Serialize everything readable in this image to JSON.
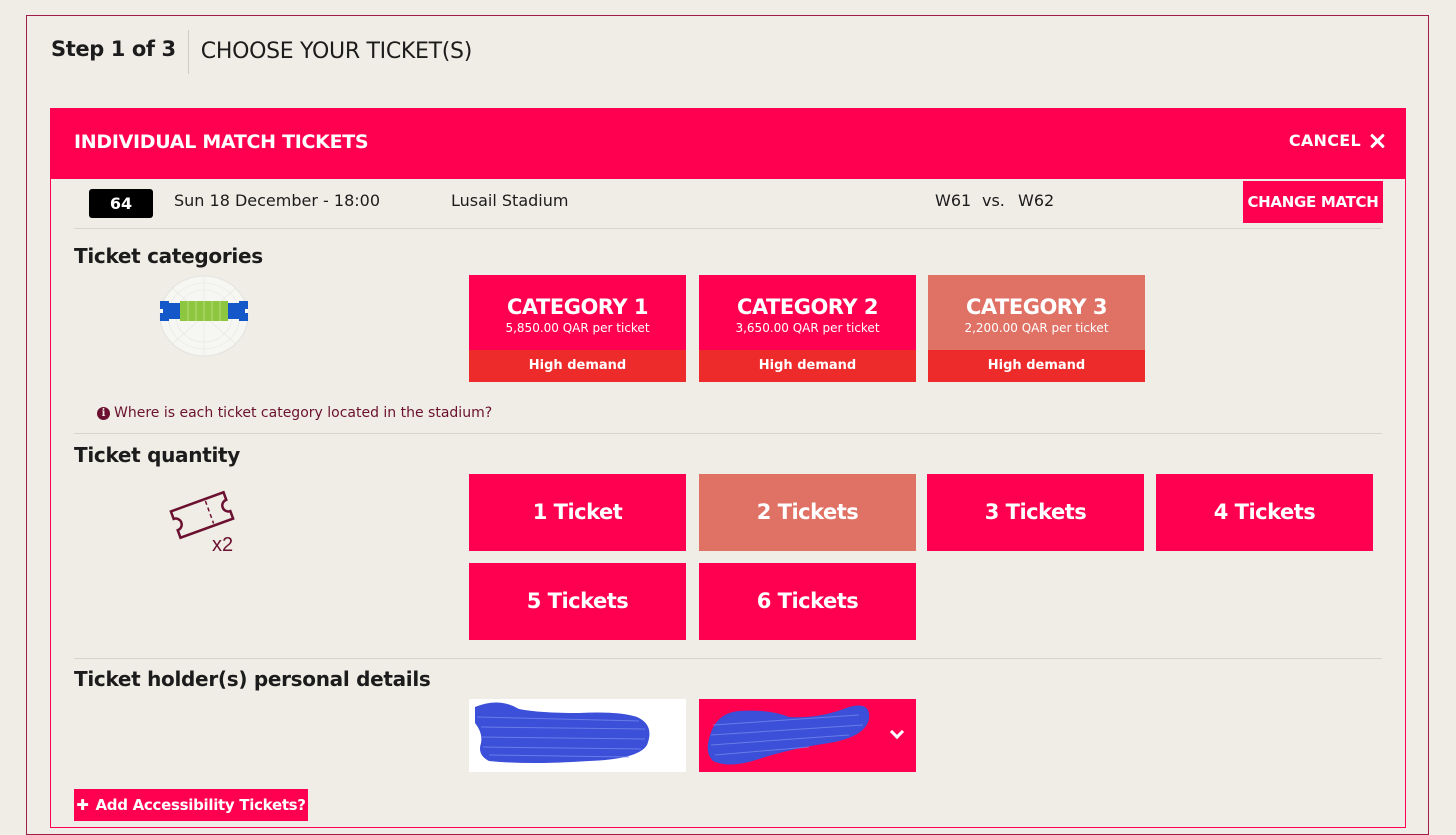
{
  "step": {
    "number": "Step 1 of 3",
    "title": "CHOOSE YOUR TICKET(S)"
  },
  "panel": {
    "title": "INDIVIDUAL MATCH TICKETS",
    "cancel_label": "CANCEL",
    "close_icon": "close-icon"
  },
  "match": {
    "number": "64",
    "date": "Sun 18 December - 18:00",
    "venue": "Lusail Stadium",
    "team1": "W61",
    "vs": "vs.",
    "team2": "W62",
    "change_label": "CHANGE MATCH"
  },
  "categories": {
    "label": "Ticket categories",
    "icon": "stadium-map-icon",
    "items": [
      {
        "name": "CATEGORY 1",
        "price": "5,850.00 QAR per ticket",
        "demand": "High demand",
        "selected": false
      },
      {
        "name": "CATEGORY 2",
        "price": "3,650.00 QAR per ticket",
        "demand": "High demand",
        "selected": false
      },
      {
        "name": "CATEGORY 3",
        "price": "2,200.00 QAR per ticket",
        "demand": "High demand",
        "selected": true
      }
    ],
    "info_icon": "info-icon",
    "info_text": "Where is each ticket category located in the stadium?"
  },
  "quantity": {
    "label": "Ticket quantity",
    "icon": "ticket-icon",
    "icon_text": "x2",
    "options": [
      "1 Ticket",
      "2 Tickets",
      "3 Tickets",
      "4 Tickets",
      "5 Tickets",
      "6 Tickets"
    ],
    "selected": "2 Tickets"
  },
  "holders": {
    "label": "Ticket holder(s) personal details",
    "dropdown_icon": "chevron-down-icon"
  },
  "accessibility": {
    "icon": "plus-icon",
    "label": "Add Accessibility Tickets?"
  },
  "colors": {
    "primary": "#ff0050",
    "selected": "#e07165",
    "demand": "#ee2b2b",
    "background": "#efede5",
    "info_text": "#6b1030"
  }
}
